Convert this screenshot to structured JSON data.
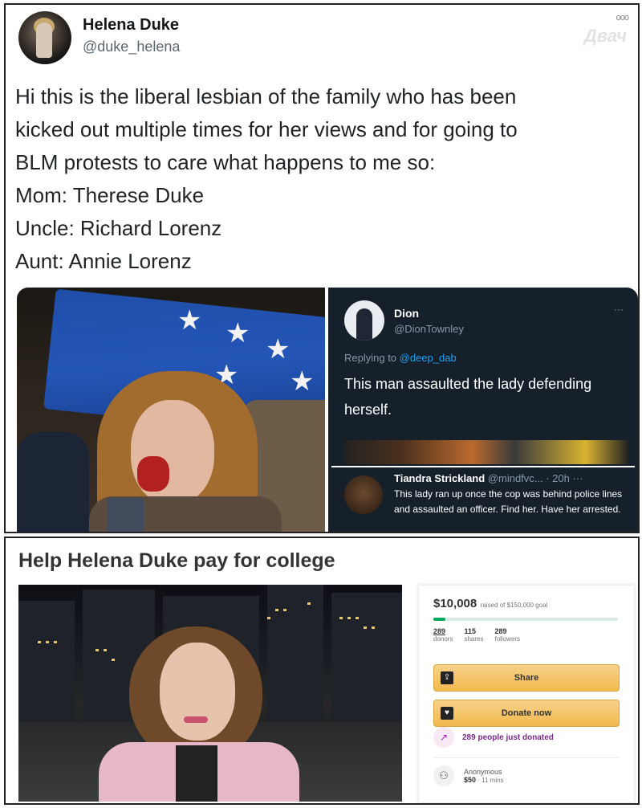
{
  "tweet": {
    "name": "Helena Duke",
    "handle": "@duke_helena",
    "more_icon": "ooo",
    "watermark": "Двач",
    "lines": [
      "Hi this is the liberal lesbian of the family who has been",
      "kicked out multiple times for her views and for going to",
      "BLM protests to care what happens to me so:",
      "Mom: Therese Duke",
      "Uncle: Richard Lorenz",
      "Aunt: Annie Lorenz"
    ],
    "embedded": {
      "top": {
        "name": "Dion",
        "handle": "@DionTownley",
        "more": "···",
        "replying_prefix": "Replying to ",
        "replying_to": "@deep_dab",
        "text": "This man assaulted the lady defending herself."
      },
      "bottom": {
        "name": "Tiandra Strickland",
        "meta": "@mindfvc... · 20h",
        "more": "···",
        "text": "This lady ran up once the cop was behind police lines and assaulted an officer. Find her. Have her arrested."
      }
    }
  },
  "fundraiser": {
    "title": "Help Helena Duke pay for college",
    "amount": "$10,008",
    "goal_text": "raised of $150,000 goal",
    "progress_fraction": 0.0667,
    "stats": [
      {
        "value": "289",
        "label": "donors"
      },
      {
        "value": "115",
        "label": "shares"
      },
      {
        "value": "289",
        "label": "followers"
      }
    ],
    "share_label": "Share",
    "donate_label": "Donate now",
    "trend_text": "289 people just donated",
    "donor_name": "Anonymous",
    "donor_amount": "$50",
    "donor_time": "11 mins"
  },
  "colors": {
    "twitter_dark_bg": "#15202b",
    "link_blue": "#1da1f2",
    "gfm_green": "#02a95c",
    "button_gold": "#f2b94d",
    "trend_purple": "#7a2b8a"
  }
}
